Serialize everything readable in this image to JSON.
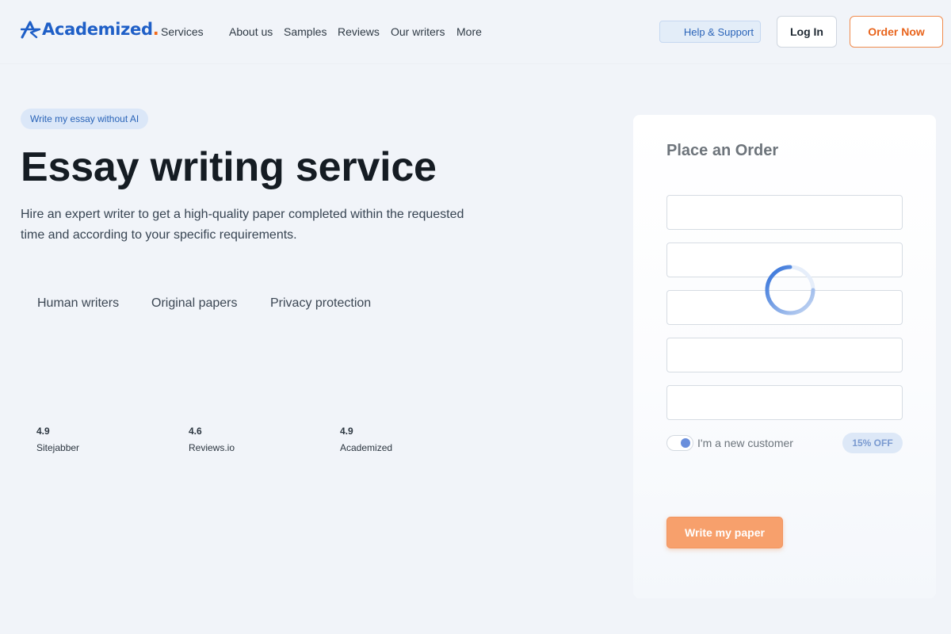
{
  "header": {
    "logo_text": "Academized",
    "logo_dot": ".",
    "nav": [
      "Services",
      "About us",
      "Samples",
      "Reviews",
      "Our writers",
      "More"
    ],
    "help_label": "Help & Support",
    "login_label": "Log In",
    "order_label": "Order Now"
  },
  "hero": {
    "pill": "Write my essay without AI",
    "title": "Essay writing service",
    "subtitle": "Hire an expert writer to get a high-quality paper completed within the requested time and according to your specific requirements.",
    "features": [
      "Human writers",
      "Original papers",
      "Privacy protection"
    ],
    "ratings": [
      {
        "value": "4.9",
        "source": "Sitejabber"
      },
      {
        "value": "4.6",
        "source": "Reviews.io"
      },
      {
        "value": "4.9",
        "source": "Academized"
      }
    ]
  },
  "order_form": {
    "title": "Place an Order",
    "new_customer_label": "I'm a new customer",
    "new_customer_on": true,
    "discount": "15% OFF",
    "submit_label": "Write my paper"
  },
  "colors": {
    "brand_blue": "#1f5fc7",
    "accent_orange": "#e8641c",
    "page_bg": "#f1f4f9"
  }
}
